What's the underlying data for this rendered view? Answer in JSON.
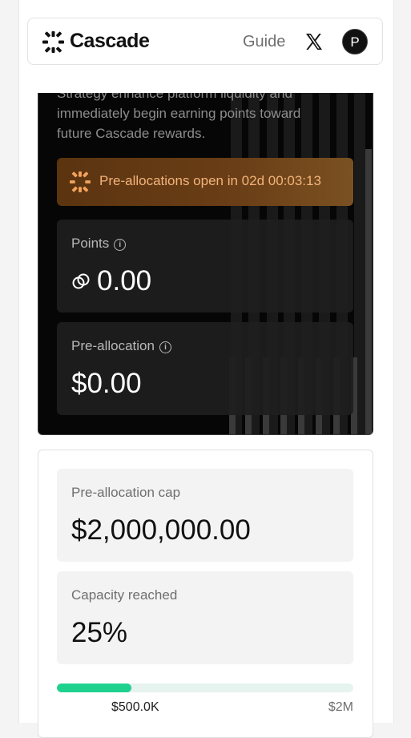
{
  "header": {
    "brand": "Cascade",
    "guide_label": "Guide",
    "avatar_initial": "P"
  },
  "hero": {
    "description": "Strategy enhance platform liquidity and immediately begin earning points toward future Cascade rewards.",
    "banner_text": "Pre-allocations open in 02d 00:03:13",
    "points": {
      "label": "Points",
      "value": "0.00"
    },
    "preallocation": {
      "label": "Pre-allocation",
      "value": "$0.00"
    }
  },
  "capacity": {
    "cap_label": "Pre-allocation cap",
    "cap_value": "$2,000,000.00",
    "reached_label": "Capacity reached",
    "reached_value": "25%",
    "progress_fraction": 0.25,
    "progress_current": "$500.0K",
    "progress_max": "$2M"
  },
  "colors": {
    "accent_green": "#1fd18f",
    "banner_text": "#f3b37a",
    "banner_bg": "#5b3410"
  }
}
